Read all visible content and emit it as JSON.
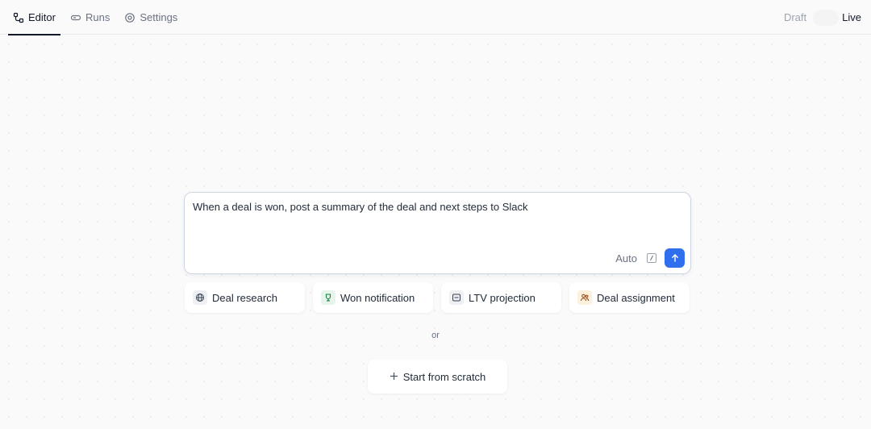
{
  "tabs": [
    {
      "label": "Editor",
      "icon": "workflow-icon",
      "active": true
    },
    {
      "label": "Runs",
      "icon": "runs-icon",
      "active": false
    },
    {
      "label": "Settings",
      "icon": "gear-icon",
      "active": false
    }
  ],
  "mode": {
    "draft_label": "Draft",
    "live_label": "Live"
  },
  "prompt": {
    "text": "When a deal is won, post a summary of the deal and next steps to Slack",
    "auto_label": "Auto",
    "slash_icon": "slash-command-icon",
    "send_icon": "arrow-up-icon",
    "accent": "#2f6fed"
  },
  "suggestions": [
    {
      "label": "Deal research",
      "icon": "globe-icon",
      "icon_bg": "#eef0f3"
    },
    {
      "label": "Won notification",
      "icon": "trophy-icon",
      "icon_bg": "#e6f4ec"
    },
    {
      "label": "LTV projection",
      "icon": "chart-icon",
      "icon_bg": "#eef0f3"
    },
    {
      "label": "Deal assignment",
      "icon": "users-icon",
      "icon_bg": "#fbf1dc"
    }
  ],
  "divider_text": "or",
  "start_button": {
    "label": "Start from scratch",
    "icon": "plus-icon"
  }
}
